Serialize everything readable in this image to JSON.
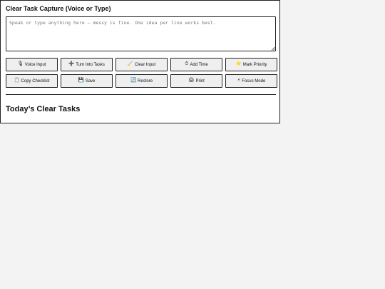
{
  "capture": {
    "title": "Clear Task Capture (Voice or Type)",
    "placeholder": "Speak or type anything here — messy is fine. One idea per line works best.",
    "value": ""
  },
  "buttons_row1": [
    {
      "icon": "🎙",
      "icon_name": "microphone-icon",
      "label": "Voice Input"
    },
    {
      "icon": "➕",
      "icon_name": "plus-icon",
      "label": "Turn Into Tasks"
    },
    {
      "icon": "🧹",
      "icon_name": "broom-icon",
      "label": "Clear Input"
    },
    {
      "icon": "⏱",
      "icon_name": "stopwatch-icon",
      "label": "Add Time"
    },
    {
      "icon": "⭐",
      "icon_name": "star-icon",
      "label": "Mark Priority"
    }
  ],
  "buttons_row2": [
    {
      "icon": "📋",
      "icon_name": "clipboard-icon",
      "label": "Copy Checklist"
    },
    {
      "icon": "💾",
      "icon_name": "floppy-disk-icon",
      "label": "Save"
    },
    {
      "icon": "🔄",
      "icon_name": "refresh-icon",
      "label": "Restore"
    },
    {
      "icon": "🖨",
      "icon_name": "printer-icon",
      "label": "Print"
    },
    {
      "icon": "⚡",
      "icon_name": "lightning-icon",
      "label": "Focus Mode"
    }
  ],
  "tasks": {
    "heading": "Today’s Clear Tasks"
  }
}
